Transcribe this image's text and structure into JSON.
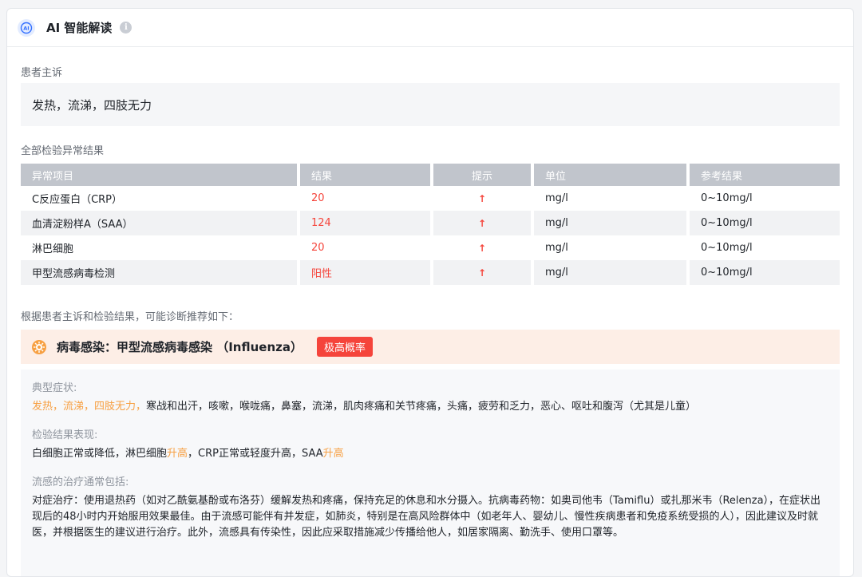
{
  "header": {
    "title": "AI 智能解读",
    "info_glyph": "i"
  },
  "complaint": {
    "label": "患者主诉",
    "text": "发热，流涕，四肢无力"
  },
  "results": {
    "label": "全部检验异常结果",
    "columns": [
      "异常项目",
      "结果",
      "提示",
      "单位",
      "参考结果"
    ],
    "rows": [
      {
        "item": "C反应蛋白（CRP）",
        "value": "20",
        "hint": "↑",
        "unit": "mg/l",
        "ref": "0~10mg/l"
      },
      {
        "item": "血清淀粉样A（SAA）",
        "value": "124",
        "hint": "↑",
        "unit": "mg/l",
        "ref": "0~10mg/l"
      },
      {
        "item": "淋巴细胞",
        "value": "20",
        "hint": "↑",
        "unit": "mg/l",
        "ref": "0~10mg/l"
      },
      {
        "item": "甲型流感病毒检测",
        "value": "阳性",
        "hint": "↑",
        "unit": "mg/l",
        "ref": "0~10mg/l"
      }
    ]
  },
  "diagnosis": {
    "intro": "根据患者主诉和检验结果，可能诊断推荐如下：",
    "title": "病毒感染：甲型流感病毒感染 （Influenza）",
    "badge": "极高概率",
    "symptoms_label": "典型症状:",
    "symptoms_highlight": "发热，流涕，四肢无力，",
    "symptoms_rest": "寒战和出汗，咳嗽，喉咙痛，鼻塞，流涕，肌肉疼痛和关节疼痛，头痛，疲劳和乏力，恶心、呕吐和腹泻（尤其是儿童）",
    "lab_label": "检验结果表现:",
    "lab_part1": "白细胞正常或降低，淋巴细胞",
    "lab_hl1": "升高",
    "lab_part2": "，CRP正常或轻度升高，SAA",
    "lab_hl2": "升高",
    "treat_label": "流感的治疗通常包括:",
    "treat_text": "对症治疗：使用退热药（如对乙酰氨基酚或布洛芬）缓解发热和疼痛，保持充足的休息和水分摄入。抗病毒药物：如奥司他韦（Tamiflu）或扎那米韦（Relenza），在症状出现后的48小时内开始服用效果最佳。由于流感可能伴有并发症，如肺炎，特别是在高风险群体中（如老年人、婴幼儿、慢性疾病患者和免疫系统受损的人），因此建议及时就医，并根据医生的建议进行治疗。此外，流感具有传染性，因此应采取措施减少传播给他人，如居家隔离、勤洗手、使用口罩等。"
  },
  "colors": {
    "accent_red": "#f5443b",
    "highlight_orange": "#f7a043",
    "diag_bg": "#fdeee6"
  }
}
